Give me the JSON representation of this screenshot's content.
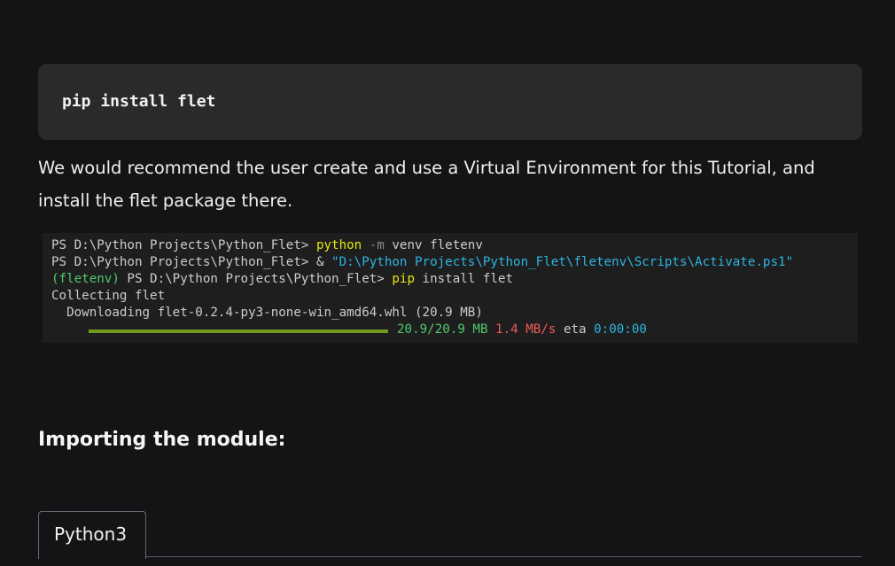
{
  "install_code": "pip install flet",
  "recommendation": "We would recommend the user create and use a Virtual Environment for this Tutorial, and install the flet package there.",
  "terminal": {
    "line1": {
      "prompt": "PS D:\\Python Projects\\Python_Flet> ",
      "cmd": "python",
      "flag": " -m",
      "args": " venv fletenv"
    },
    "line2": {
      "prompt": "PS D:\\Python Projects\\Python_Flet> & ",
      "path": "\"D:\\Python Projects\\Python_Flet\\fletenv\\Scripts\\Activate.ps1\""
    },
    "line3": {
      "env": "(fletenv)",
      "prompt": " PS D:\\Python Projects\\Python_Flet> ",
      "cmd": "pip",
      "args": " install flet"
    },
    "line4": "Collecting flet",
    "line5": "  Downloading flet-0.2.4-py3-none-win_amd64.whl (20.9 MB)",
    "progress": {
      "fraction": 1.0,
      "downloaded": "20.9/20.9 MB",
      "speed": "1.4 MB/s",
      "eta_label": "eta",
      "eta_value": "0:00:00"
    },
    "colors": {
      "progress_bar": "#6f9a1e",
      "command": "#e5e510",
      "path_string": "#2cb5e0",
      "env_name": "#4ec96b",
      "speed": "#f25a5a"
    }
  },
  "section_heading": "Importing the module:",
  "code_tabs": [
    {
      "label": "Python3",
      "active": true
    }
  ],
  "colors": {
    "page_background": "#141416",
    "code_block_background": "#2a2a2d",
    "terminal_background": "#1e1e1e"
  }
}
